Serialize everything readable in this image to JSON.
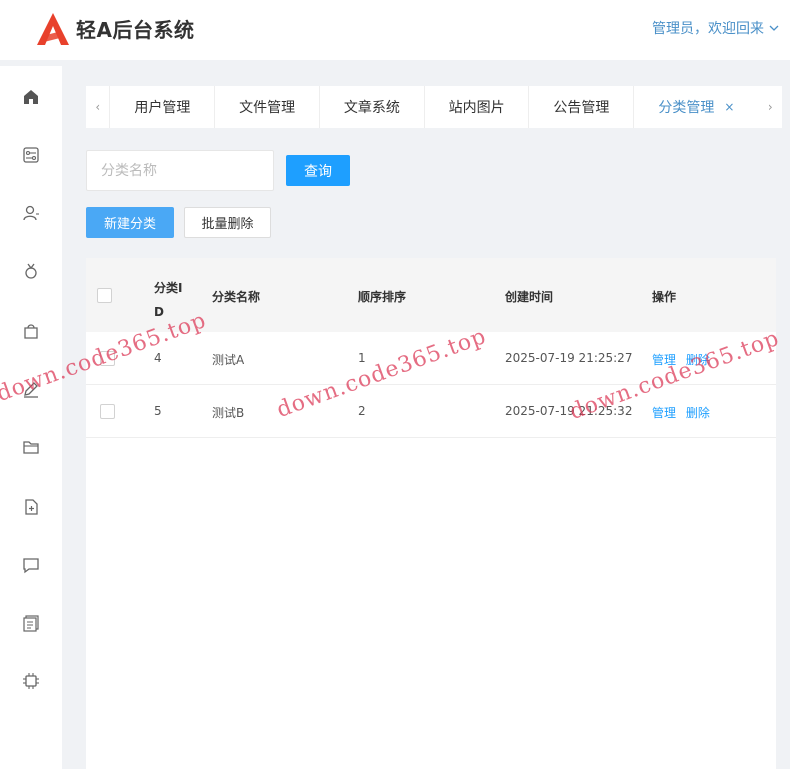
{
  "app": {
    "title": "轻A后台系统",
    "brand_color": "#e8412c"
  },
  "user_menu": {
    "label": "管理员，欢迎回来"
  },
  "sidebar": {
    "icons": [
      "home-icon",
      "dashboard-icon",
      "user-icon",
      "role-icon",
      "shopping-bag-icon",
      "edit-icon",
      "folder-icon",
      "file-add-icon",
      "message-icon",
      "document-icon",
      "chip-icon"
    ]
  },
  "tabs": [
    {
      "label": "用户管理"
    },
    {
      "label": "文件管理"
    },
    {
      "label": "文章系统"
    },
    {
      "label": "站内图片"
    },
    {
      "label": "公告管理"
    },
    {
      "label": "分类管理",
      "active": true
    }
  ],
  "search": {
    "placeholder": "分类名称",
    "value": "",
    "query_label": "查询"
  },
  "toolbar": {
    "new_label": "新建分类",
    "batch_delete_label": "批量删除"
  },
  "table": {
    "headers": {
      "id_line1": "分类I",
      "id_line2": "D",
      "name": "分类名称",
      "order": "顺序排序",
      "created": "创建时间",
      "actions": "操作"
    },
    "rows": [
      {
        "id": "4",
        "name": "测试A",
        "order": "1",
        "created": "2025-07-19 21:25:27",
        "manage": "管理",
        "delete": "删除"
      },
      {
        "id": "5",
        "name": "测试B",
        "order": "2",
        "created": "2025-07-19 21:25:32",
        "manage": "管理",
        "delete": "删除"
      }
    ]
  },
  "watermarks": [
    "down.code365.top",
    "down.code365.top",
    "down.code365.top"
  ],
  "colors": {
    "primary": "#1e9fff",
    "link": "#4a90c8"
  }
}
